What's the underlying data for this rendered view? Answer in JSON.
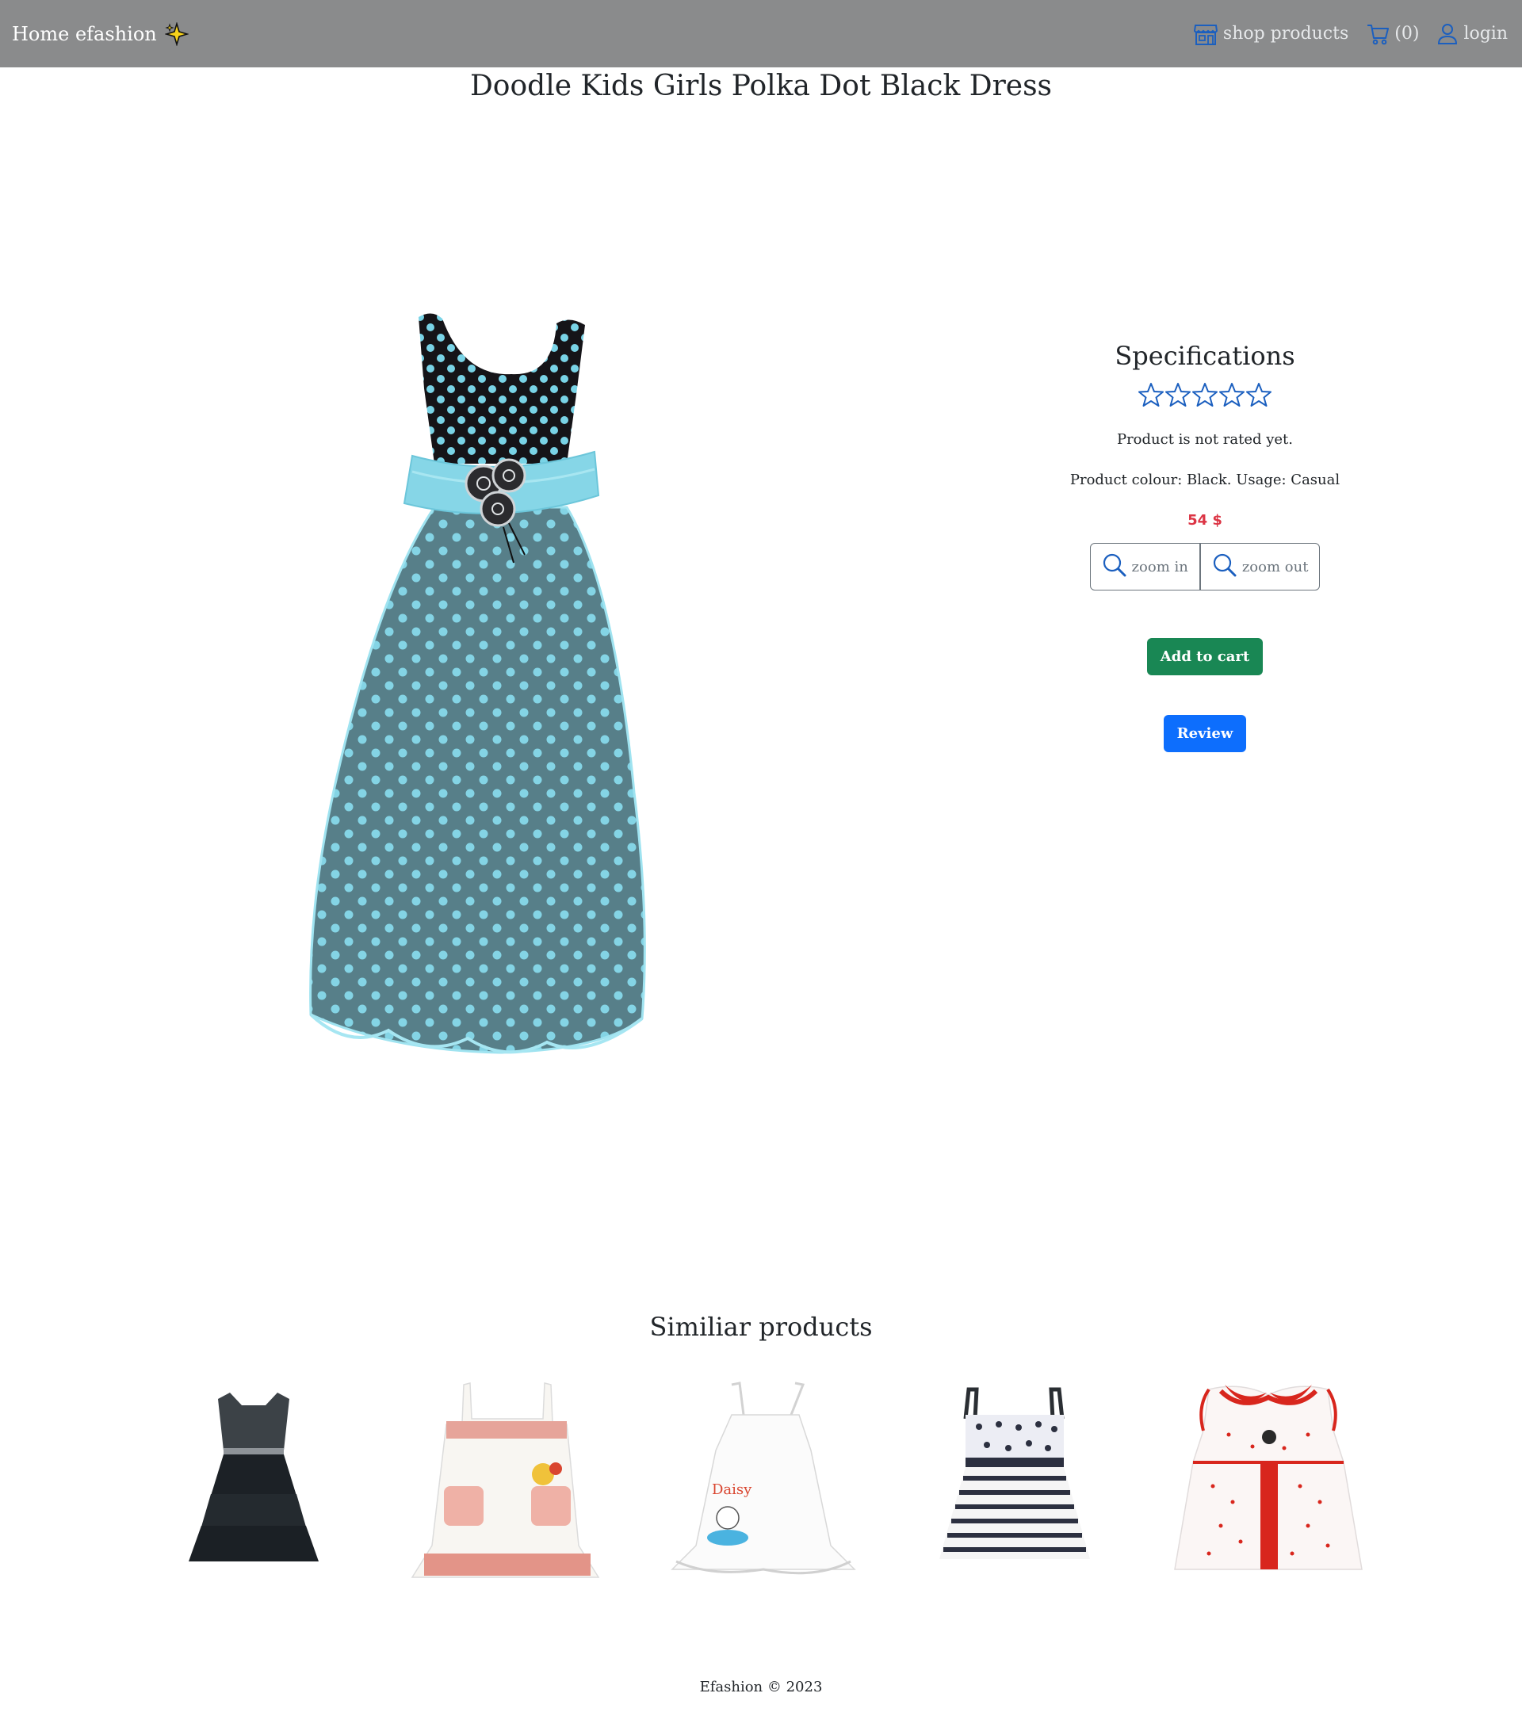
{
  "navbar": {
    "brand": "Home efashion",
    "shop_label": "shop products",
    "cart_label": "(0)",
    "login_label": "login"
  },
  "product": {
    "title": "Doodle Kids Girls Polka Dot Black Dress",
    "specs_title": "Specifications",
    "rating": 0,
    "rating_max": 5,
    "rating_text": "Product is not rated yet.",
    "details": "Product colour: Black. Usage: Casual",
    "price": "54 $",
    "zoom_in_label": "zoom in",
    "zoom_out_label": "zoom out",
    "add_to_cart_label": "Add to cart",
    "review_label": "Review"
  },
  "similar": {
    "title": "Similiar products",
    "items": [
      "black-tiered-dress-image",
      "white-red-pocket-dress-image",
      "white-daisy-dress-image",
      "striped-polka-dress-image",
      "red-dotted-collar-dress-image"
    ]
  },
  "footer": {
    "text": "Efashion © 2023"
  },
  "colors": {
    "navbar": "#8a8b8c",
    "icon_blue": "#1b5fbf",
    "price": "#dc3545",
    "cart_button": "#198754",
    "review_button": "#0d6efd"
  }
}
